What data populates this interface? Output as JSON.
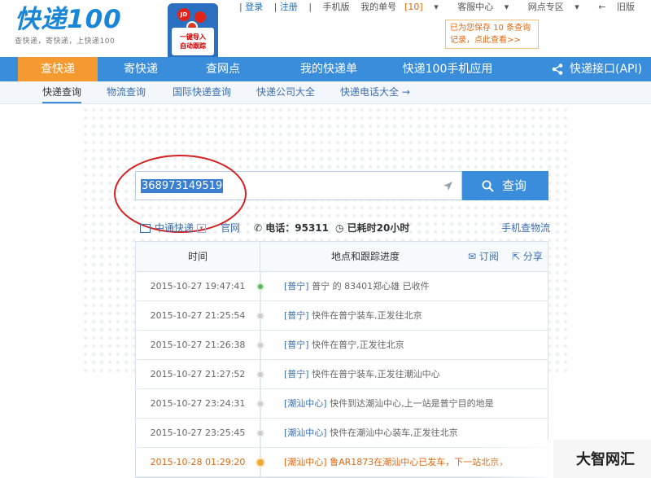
{
  "logo": {
    "text": "快递100",
    "slogan": "查快递，寄快递，上快递100"
  },
  "promo": {
    "jd": "JD",
    "line1": "一键导入",
    "line2": "自动跟踪"
  },
  "topnav": {
    "login": "登录",
    "register": "注册",
    "mobile": "手机版",
    "my_orders": "我的单号",
    "my_orders_count": "[10]",
    "service": "客服中心",
    "outlets_zone": "网点专区",
    "old": "旧版"
  },
  "tip": {
    "line1": "已为您保存 10 条查询",
    "line2": "记录，点此查看>>"
  },
  "mainnav": {
    "items": [
      "查快递",
      "寄快递",
      "查网点",
      "我的快递单",
      "快递100手机应用"
    ],
    "api": "快递接口(API)"
  },
  "subnav": {
    "items": [
      "快递查询",
      "物流查询",
      "国际快递查询",
      "快递公司大全",
      "快递电话大全 →"
    ]
  },
  "search": {
    "value": "368973149519",
    "button": "查询"
  },
  "info": {
    "company": "中通快递",
    "official": "官网",
    "phone": "电话：95311",
    "elapsed": "已耗时20小时",
    "mobile": "手机查物流"
  },
  "table": {
    "col_time": "时间",
    "col_location": "地点和跟踪进度",
    "subscribe": "订阅",
    "share": "分享",
    "rows": [
      {
        "time": "2015-10-27 19:47:41",
        "loc": "[普宁]",
        "desc": " 普宁 的 83401郑心雄 已收件"
      },
      {
        "time": "2015-10-27 21:25:54",
        "loc": "[普宁]",
        "desc": " 快件在普宁装车,正发往北京"
      },
      {
        "time": "2015-10-27 21:26:38",
        "loc": "[普宁]",
        "desc": " 快件在普宁,正发往北京"
      },
      {
        "time": "2015-10-27 21:27:52",
        "loc": "[普宁]",
        "desc": " 快件在普宁装车,正发往潮汕中心"
      },
      {
        "time": "2015-10-27 23:24:31",
        "loc": "[潮汕中心]",
        "desc": " 快件到达潮汕中心,上一站是普宁目的地是"
      },
      {
        "time": "2015-10-27 23:25:45",
        "loc": "[潮汕中心]",
        "desc": " 快件在潮汕中心装车,正发往北京"
      },
      {
        "time": "2015-10-28 01:29:20",
        "loc": "[潮汕中心]",
        "desc": " 鲁AR1873在潮汕中心已发车，下一站北京，"
      }
    ]
  },
  "watermark": "大智网汇"
}
